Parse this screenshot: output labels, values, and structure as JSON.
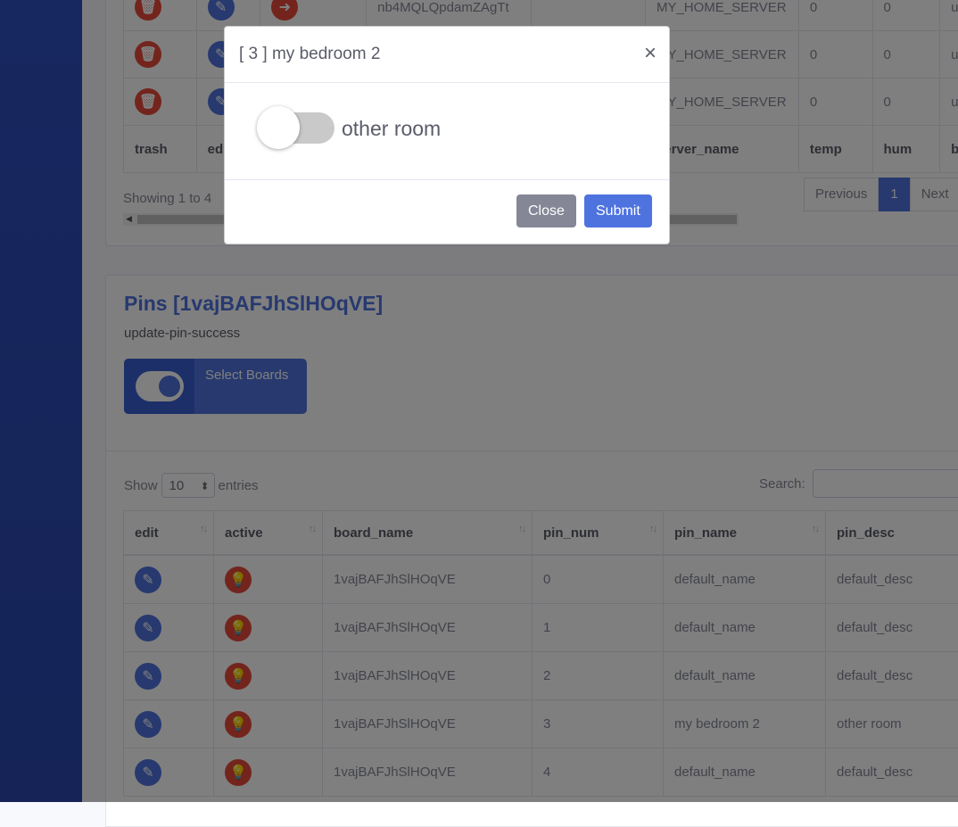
{
  "top_table": {
    "rows": [
      {
        "board": "nb4MQLQpdamZAgTt",
        "server": "MY_HOME_SERVER",
        "temp": "0",
        "hum": "0",
        "extra": "u"
      },
      {
        "board": "",
        "server": "MY_HOME_SERVER",
        "temp": "0",
        "hum": "0",
        "extra": "u"
      },
      {
        "board": "",
        "server": "MY_HOME_SERVER",
        "temp": "0",
        "hum": "0",
        "extra": "u"
      }
    ],
    "footer": {
      "trash": "trash",
      "edit": "edit",
      "server_name": "server_name",
      "temp": "temp",
      "hum": "hum",
      "last": "b"
    },
    "showing": "Showing 1 to 4",
    "pager": {
      "previous": "Previous",
      "page": "1",
      "next": "Next"
    }
  },
  "pins": {
    "title": "Pins [1vajBAFJhSlHOqVE]",
    "message": "update-pin-success",
    "select_boards": "Select Boards"
  },
  "pins_table": {
    "show": "Show",
    "entries_value": "10",
    "entries": "entries",
    "search_label": "Search:",
    "headers": [
      "edit",
      "active",
      "board_name",
      "pin_num",
      "pin_name",
      "pin_desc"
    ],
    "rows": [
      {
        "board_name": "1vajBAFJhSlHOqVE",
        "pin_num": "0",
        "pin_name": "default_name",
        "pin_desc": "default_desc"
      },
      {
        "board_name": "1vajBAFJhSlHOqVE",
        "pin_num": "1",
        "pin_name": "default_name",
        "pin_desc": "default_desc"
      },
      {
        "board_name": "1vajBAFJhSlHOqVE",
        "pin_num": "2",
        "pin_name": "default_name",
        "pin_desc": "default_desc"
      },
      {
        "board_name": "1vajBAFJhSlHOqVE",
        "pin_num": "3",
        "pin_name": "my bedroom 2",
        "pin_desc": "other room"
      },
      {
        "board_name": "1vajBAFJhSlHOqVE",
        "pin_num": "4",
        "pin_name": "default_name",
        "pin_desc": "default_desc"
      }
    ]
  },
  "modal": {
    "title": "[ 3 ] my bedroom 2",
    "close_symbol": "×",
    "toggle_label": "other room",
    "close_button": "Close",
    "submit_button": "Submit"
  },
  "colors": {
    "primary": "#4e73df",
    "danger": "#e74a3b",
    "secondary": "#858796"
  },
  "icons": {
    "trash": "trash-icon",
    "edit": "edit-icon",
    "active": "lightbulb-icon",
    "sort": "sort-icon"
  }
}
